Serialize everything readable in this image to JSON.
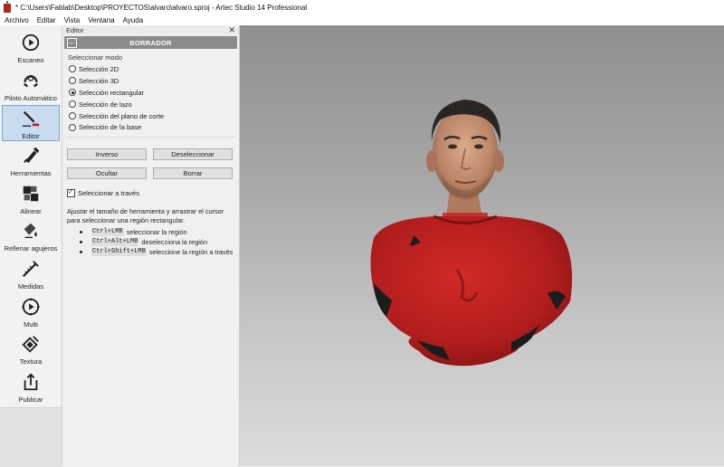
{
  "window": {
    "title": "* C:\\Users\\Fablab\\Desktop\\PROYECTOS\\alvaro\\alvaro.sproj - Artec Studio 14 Professional"
  },
  "menu": [
    "Archivo",
    "Editar",
    "Vista",
    "Ventana",
    "Ayuda"
  ],
  "sidebar": {
    "items": [
      {
        "label": "Escaneo",
        "icon": "scan-icon"
      },
      {
        "label": "Piloto Automático",
        "icon": "autopilot-icon"
      },
      {
        "label": "Editor",
        "icon": "editor-icon",
        "active": true
      },
      {
        "label": "Herramientas",
        "icon": "tools-icon"
      },
      {
        "label": "Alinear",
        "icon": "align-icon"
      },
      {
        "label": "Rellenar agujeros",
        "icon": "fill-holes-icon"
      },
      {
        "label": "Medidas",
        "icon": "measures-icon"
      },
      {
        "label": "Multi",
        "icon": "multi-icon"
      },
      {
        "label": "Textura",
        "icon": "texture-icon"
      },
      {
        "label": "Publicar",
        "icon": "publish-icon"
      }
    ]
  },
  "editor": {
    "panel_title": "Editor",
    "close_glyph": "✕",
    "back_glyph": "←",
    "header": "BORRADOR",
    "mode_title": "Seleccionar modo",
    "modes": [
      {
        "label": "Selección 2D",
        "checked": false
      },
      {
        "label": "Selección 3D",
        "checked": false
      },
      {
        "label": "Selección rectangular",
        "checked": true
      },
      {
        "label": "Selección de lazo",
        "checked": false
      },
      {
        "label": "Selección del plano de corte",
        "checked": false
      },
      {
        "label": "Selección de la base",
        "checked": false
      }
    ],
    "buttons": {
      "inverse": "Inverso",
      "deselect": "Deseleccionar",
      "hide": "Ocultar",
      "erase": "Borrar"
    },
    "through_checkbox": {
      "label": "Seleccionar a través",
      "checked": true
    },
    "help_text": "Ajustar el tamaño de herramienta y arrastrar el cursor para seleccionar una región rectangular.",
    "shortcuts": [
      {
        "keys": "Ctrl+LMB",
        "text": "seleccionar la región"
      },
      {
        "keys": "Ctrl+Alt+LMB",
        "text": "deselecciona la región"
      },
      {
        "keys": "Ctrl+Shift+LMB",
        "text": "seleccione la región a través"
      }
    ]
  },
  "colors": {
    "selection_red": "#c42020",
    "active_nav": "#c9dcef",
    "header_gray": "#8b8b8b"
  }
}
